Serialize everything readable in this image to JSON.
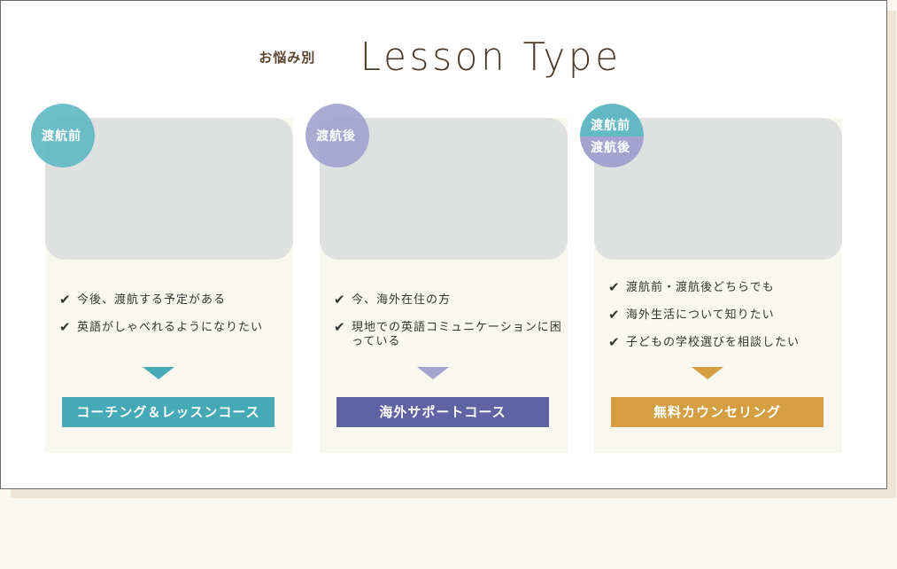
{
  "heading": {
    "sub": "お悩み別",
    "main": "Lesson Type"
  },
  "cards": [
    {
      "badge": "渡航前",
      "items": [
        "今後、渡航する予定がある",
        "英語がしゃべれるようになりたい"
      ],
      "button": "コーチング＆レッスンコース",
      "color": "#45a9b6"
    },
    {
      "badge": "渡航後",
      "items": [
        "今、海外在住の方",
        "現地での英語コミュニケーションに困っている"
      ],
      "button": "海外サポートコース",
      "color": "#5f63a4",
      "arrow_color": "#a4a3d0"
    },
    {
      "badge_top": "渡航前",
      "badge_bottom": "渡航後",
      "items": [
        "渡航前・渡航後どちらでも",
        "海外生活について知りたい",
        "子どもの学校選びを相談したい"
      ],
      "button": "無料カウンセリング",
      "color": "#d59e42"
    }
  ],
  "check_icon": "✔"
}
